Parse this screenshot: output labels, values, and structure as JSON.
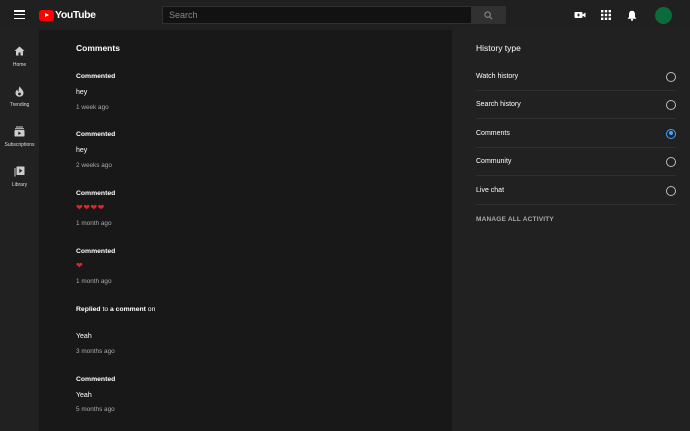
{
  "header": {
    "logo_text": "YouTube",
    "search_placeholder": "Search",
    "icons": [
      "menu-icon",
      "search-icon",
      "create-video-icon",
      "apps-icon",
      "notifications-icon"
    ]
  },
  "sidebar": {
    "items": [
      {
        "label": "Home",
        "icon": "home-icon"
      },
      {
        "label": "Trending",
        "icon": "trending-icon"
      },
      {
        "label": "Subscriptions",
        "icon": "subscriptions-icon"
      },
      {
        "label": "Library",
        "icon": "library-icon"
      }
    ]
  },
  "main": {
    "title": "Comments",
    "entries": [
      {
        "action": "Commented",
        "text": "hey",
        "time": "1 week ago"
      },
      {
        "action": "Commented",
        "text": "hey",
        "time": "2 weeks ago"
      },
      {
        "action": "Commented",
        "hearts": 4,
        "time": "1 month ago"
      },
      {
        "action": "Commented",
        "hearts": 1,
        "time": "1 month ago"
      },
      {
        "action": "Replied",
        "action_rest_1": " to ",
        "action_bold": "a comment",
        "action_rest_2": " on",
        "text": "Yeah",
        "time": "3 months ago"
      },
      {
        "action": "Commented",
        "text": "Yeah",
        "time": "5 months ago"
      }
    ]
  },
  "panel": {
    "title": "History type",
    "options": [
      {
        "label": "Watch history",
        "checked": false
      },
      {
        "label": "Search history",
        "checked": false
      },
      {
        "label": "Comments",
        "checked": true
      },
      {
        "label": "Community",
        "checked": false
      },
      {
        "label": "Live chat",
        "checked": false
      }
    ],
    "manage_label": "MANAGE ALL ACTIVITY"
  },
  "colors": {
    "accent": "#3ea6ff",
    "brand_red": "#ff0000",
    "avatar": "#0b6b3a"
  }
}
